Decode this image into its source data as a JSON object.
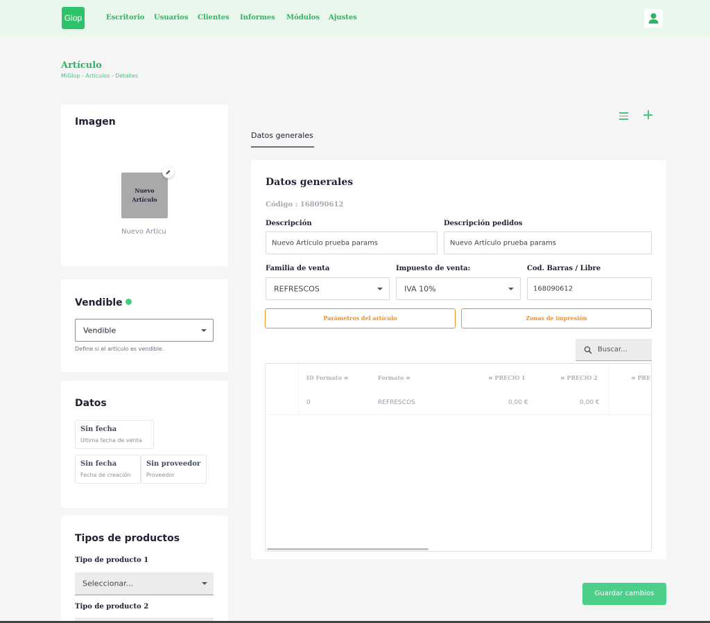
{
  "nav": {
    "logo": "Glop",
    "links": [
      "Escritorio",
      "Usuarios",
      "Clientes",
      "Informes",
      "Módulos",
      "Ajustes"
    ]
  },
  "page": {
    "title": "Artículo",
    "breadcrumb": [
      "MiGlop",
      "Artículos",
      "Detalles"
    ]
  },
  "imagen": {
    "title": "Imagen",
    "tile_line1": "Nuevo",
    "tile_line2": "Artículo",
    "caption": "Nuevo Artícu"
  },
  "vendible": {
    "title": "Vendible",
    "selected": "Vendible",
    "hint": "Define si el artículo es vendible."
  },
  "datos": {
    "title": "Datos",
    "chips": [
      {
        "value": "Sin fecha",
        "label": "Última fecha de venta"
      },
      {
        "value": "Sin fecha",
        "label": "Fecha de creación"
      },
      {
        "value": "Sin proveedor",
        "label": "Proveedor"
      }
    ]
  },
  "tipos": {
    "title": "Tipos de productos",
    "tipo1_label": "Tipo de producto 1",
    "tipo1_value": "Seleccionar...",
    "tipo2_label": "Tipo de producto 2"
  },
  "tabs": [
    "Datos generales"
  ],
  "general": {
    "title": "Datos generales",
    "code": "Código : 168090612",
    "descripcion_label": "Descripción",
    "descripcion_value": "Nuevo Artículo prueba params",
    "desc_pedidos_label": "Descripción pedidos",
    "desc_pedidos_value": "Nuevo Artículo prueba params",
    "familia_label": "Familia de venta",
    "familia_value": "REFRESCOS",
    "impuesto_label": "Impuesto de venta:",
    "impuesto_value": "IVA 10%",
    "barras_label": "Cod. Barras / Libre",
    "barras_value": "168090612",
    "btn_parametros": "Parámetros del artículo",
    "btn_zonas": "Zonas de impresión",
    "search_placeholder": "Buscar..."
  },
  "table": {
    "headers": [
      "ID Formato",
      "Formato",
      "PRECIO 1",
      "PRECIO 2",
      "PRE"
    ],
    "rows": [
      [
        "0",
        "REFRESCOS",
        "0,00 €",
        "0,00 €"
      ]
    ]
  },
  "actions": {
    "save": "Guardar cambios"
  },
  "colors": {
    "accent": "#2eb463",
    "nav_bg": "#e9f7ec",
    "orange": "#f08c2a",
    "save": "#4cd089"
  }
}
